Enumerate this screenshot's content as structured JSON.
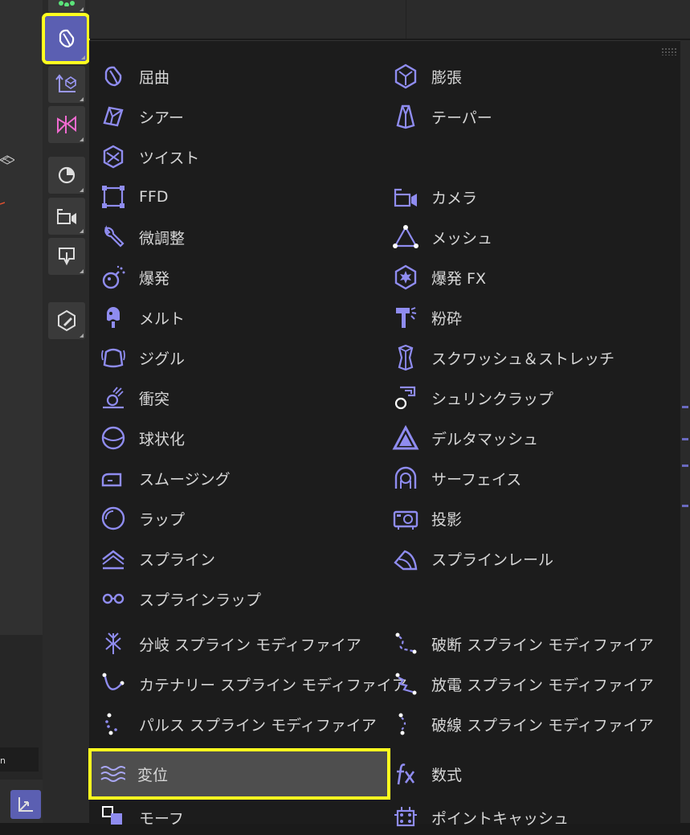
{
  "menu": {
    "left_column": [
      {
        "label": "屈曲",
        "icon": "bend-icon"
      },
      {
        "label": "シアー",
        "icon": "shear-icon"
      },
      {
        "label": "ツイスト",
        "icon": "twist-icon"
      },
      {
        "label": "FFD",
        "icon": "ffd-icon"
      },
      {
        "label": "微調整",
        "icon": "wrench-icon"
      },
      {
        "label": "爆発",
        "icon": "bomb-icon"
      },
      {
        "label": "メルト",
        "icon": "melt-icon"
      },
      {
        "label": "ジグル",
        "icon": "jiggle-icon"
      },
      {
        "label": "衝突",
        "icon": "collision-icon"
      },
      {
        "label": "球状化",
        "icon": "spherify-icon"
      },
      {
        "label": "スムージング",
        "icon": "smoothing-icon"
      },
      {
        "label": "ラップ",
        "icon": "wrap-icon"
      },
      {
        "label": "スプライン",
        "icon": "spline-icon"
      },
      {
        "label": "スプラインラップ",
        "icon": "spline-wrap-icon"
      },
      {
        "label": "分岐 スプライン モディファイア",
        "icon": "branch-spline-icon"
      },
      {
        "label": "カテナリー スプライン モディファイア",
        "icon": "catenary-spline-icon"
      },
      {
        "label": "パルス スプライン モディファイア",
        "icon": "pulse-spline-icon"
      },
      {
        "label": "変位",
        "icon": "displace-icon"
      },
      {
        "label": "モーフ",
        "icon": "morph-icon"
      }
    ],
    "right_column": [
      {
        "label": "膨張",
        "icon": "bulge-icon"
      },
      {
        "label": "テーパー",
        "icon": "taper-icon"
      },
      {
        "label": "カメラ",
        "icon": "camera-icon"
      },
      {
        "label": "メッシュ",
        "icon": "mesh-icon"
      },
      {
        "label": "爆発 FX",
        "icon": "explosion-fx-icon"
      },
      {
        "label": "粉砕",
        "icon": "shatter-icon"
      },
      {
        "label": "スクワッシュ＆ストレッチ",
        "icon": "squash-stretch-icon"
      },
      {
        "label": "シュリンクラップ",
        "icon": "shrink-wrap-icon"
      },
      {
        "label": "デルタマッシュ",
        "icon": "delta-mush-icon"
      },
      {
        "label": "サーフェイス",
        "icon": "surface-icon"
      },
      {
        "label": "投影",
        "icon": "projection-icon"
      },
      {
        "label": "スプラインレール",
        "icon": "spline-rail-icon"
      },
      {
        "label": "破断 スプライン モディファイア",
        "icon": "break-spline-icon"
      },
      {
        "label": "放電 スプライン モディファイア",
        "icon": "discharge-spline-icon"
      },
      {
        "label": "破線 スプライン モディファイア",
        "icon": "dashed-spline-icon"
      },
      {
        "label": "数式",
        "icon": "formula-icon"
      },
      {
        "label": "ポイントキャッシュ",
        "icon": "point-cache-icon"
      }
    ],
    "selected": "変位"
  },
  "colors": {
    "accent": "#8f8cf0",
    "highlight_outline": "#ffff1f",
    "active_button": "#5b5fb2",
    "selected_row": "#4e4e4e"
  },
  "viewport": {
    "label": "n"
  }
}
